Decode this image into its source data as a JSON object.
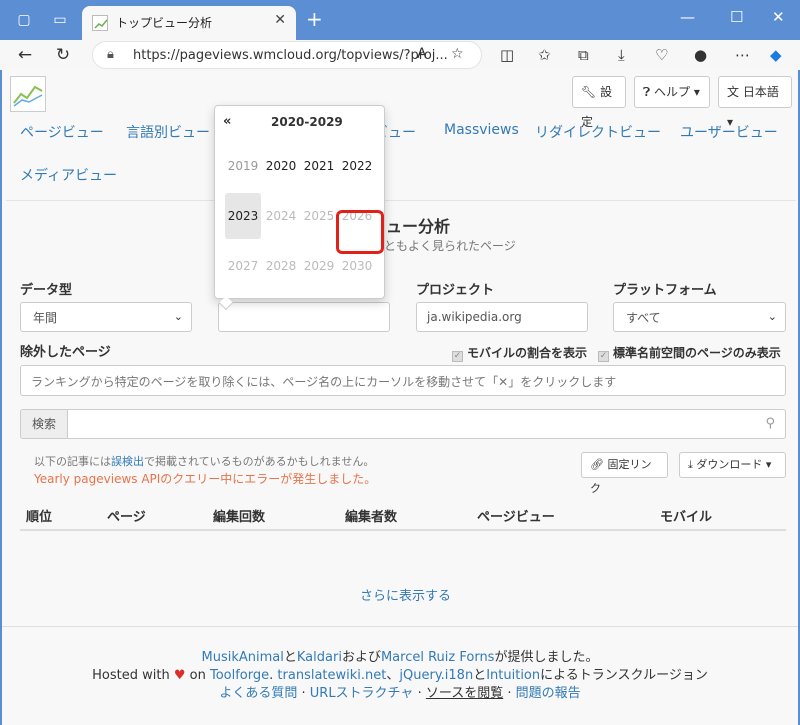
{
  "browser": {
    "tab_title": "トップビュー分析",
    "url": "https://pageviews.wmcloud.org/topviews/?proj...",
    "new_tab": "+",
    "colors": {
      "titlebar": "#5b8ed3",
      "toolbar": "#f7f7f7"
    }
  },
  "header": {
    "settings": "設定",
    "help": "ヘルプ",
    "language": "日本語"
  },
  "nav": {
    "items": [
      "ページビュー",
      "言語別ビュー",
      "ビュー",
      "Massviews",
      "リダイレクトビュー",
      "ユーザービュー",
      "メディアビュー"
    ]
  },
  "main": {
    "title": "ビュー分析",
    "subtitle": "っともよく見られたページ",
    "labels": {
      "data_type": "データ型",
      "project": "プロジェクト",
      "platform": "プラットフォーム",
      "excluded": "除外したページ"
    },
    "data_type_value": "年間",
    "project_value": "ja.wikipedia.org",
    "platform_value": "すべて",
    "checkbox_mobile": "モバイルの割合を表示",
    "checkbox_namespace": "標準名前空間のページのみ表示",
    "exclude_placeholder": "ランキングから特定のページを取り除くには、ページ名の上にカーソルを移動させて「✕」をクリックします",
    "search_label": "検索",
    "note_prefix": "以下の記事には",
    "note_link": "誤検出",
    "note_suffix": "で掲載されているものがあるかもしれません。",
    "error": "Yearly pageviews APIのクエリー中にエラーが発生しました。",
    "permalink": "固定リンク",
    "download": "ダウンロード",
    "columns": [
      "順位",
      "ページ",
      "編集回数",
      "編集者数",
      "ページビュー",
      "モバイル"
    ],
    "show_more": "さらに表示する"
  },
  "datepicker": {
    "prev": "«",
    "title": "2020-2029",
    "years": [
      {
        "label": "2019",
        "state": "old"
      },
      {
        "label": "2020",
        "state": "cur"
      },
      {
        "label": "2021",
        "state": "cur"
      },
      {
        "label": "2022",
        "state": "cur"
      },
      {
        "label": "2023",
        "state": "sel"
      },
      {
        "label": "2024",
        "state": "dis"
      },
      {
        "label": "2025",
        "state": "dis"
      },
      {
        "label": "2026",
        "state": "dis"
      },
      {
        "label": "2027",
        "state": "dis"
      },
      {
        "label": "2028",
        "state": "dis"
      },
      {
        "label": "2029",
        "state": "dis"
      },
      {
        "label": "2030",
        "state": "dis"
      }
    ],
    "highlight_color": "#e32018"
  },
  "footer": {
    "credit_a": "MusikAnimal",
    "credit_and": "と",
    "credit_b": "Kaldari",
    "credit_and2": "および",
    "credit_c": "Marcel Ruiz Forns",
    "credit_suffix": "が提供しました。",
    "hosted": "Hosted with",
    "on": "on",
    "toolforge": "Toolforge",
    "dot": ".",
    "translatewiki": "translatewiki.net",
    "comma": "、",
    "jquery": "jQuery.i18n",
    "to": "と",
    "intuition": "Intuition",
    "transclusion": "によるトランスクルージョン",
    "faq": "よくある質問",
    "sep": "·",
    "url_structure": "URLストラクチャ",
    "source": "ソースを閲覧",
    "report": "問題の報告"
  }
}
